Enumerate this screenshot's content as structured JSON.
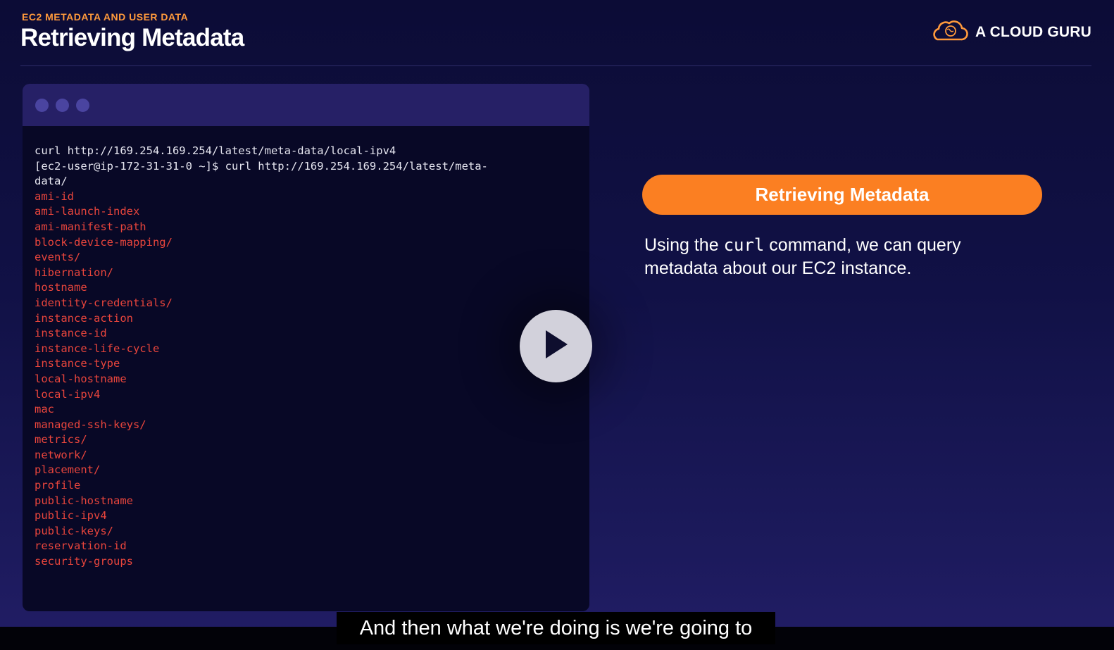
{
  "header": {
    "eyebrow": "EC2 METADATA AND USER DATA",
    "title": "Retrieving Metadata",
    "brand_name": "A CLOUD GURU"
  },
  "terminal": {
    "command_lines": [
      "curl http://169.254.169.254/latest/meta-data/local-ipv4",
      "[ec2-user@ip-172-31-31-0 ~]$ curl http://169.254.169.254/latest/meta-",
      "data/"
    ],
    "output_lines": [
      "ami-id",
      "ami-launch-index",
      "ami-manifest-path",
      "block-device-mapping/",
      "events/",
      "hibernation/",
      "hostname",
      "identity-credentials/",
      "instance-action",
      "instance-id",
      "instance-life-cycle",
      "instance-type",
      "local-hostname",
      "local-ipv4",
      "mac",
      "managed-ssh-keys/",
      "metrics/",
      "network/",
      "placement/",
      "profile",
      "public-hostname",
      "public-ipv4",
      "public-keys/",
      "reservation-id",
      "security-groups"
    ]
  },
  "slide": {
    "pill_label": "Retrieving Metadata",
    "desc_before": "Using the ",
    "desc_code": "curl",
    "desc_after": " command, we can query metadata about our EC2 instance."
  },
  "player": {
    "subtitle": "And then what we're doing is we're going to"
  },
  "colors": {
    "accent": "#fb7f22",
    "terminal_output": "#e8453c",
    "background": "#0c0c36"
  },
  "icons": {
    "brand": "cloud-logo-icon",
    "play": "play-icon"
  }
}
